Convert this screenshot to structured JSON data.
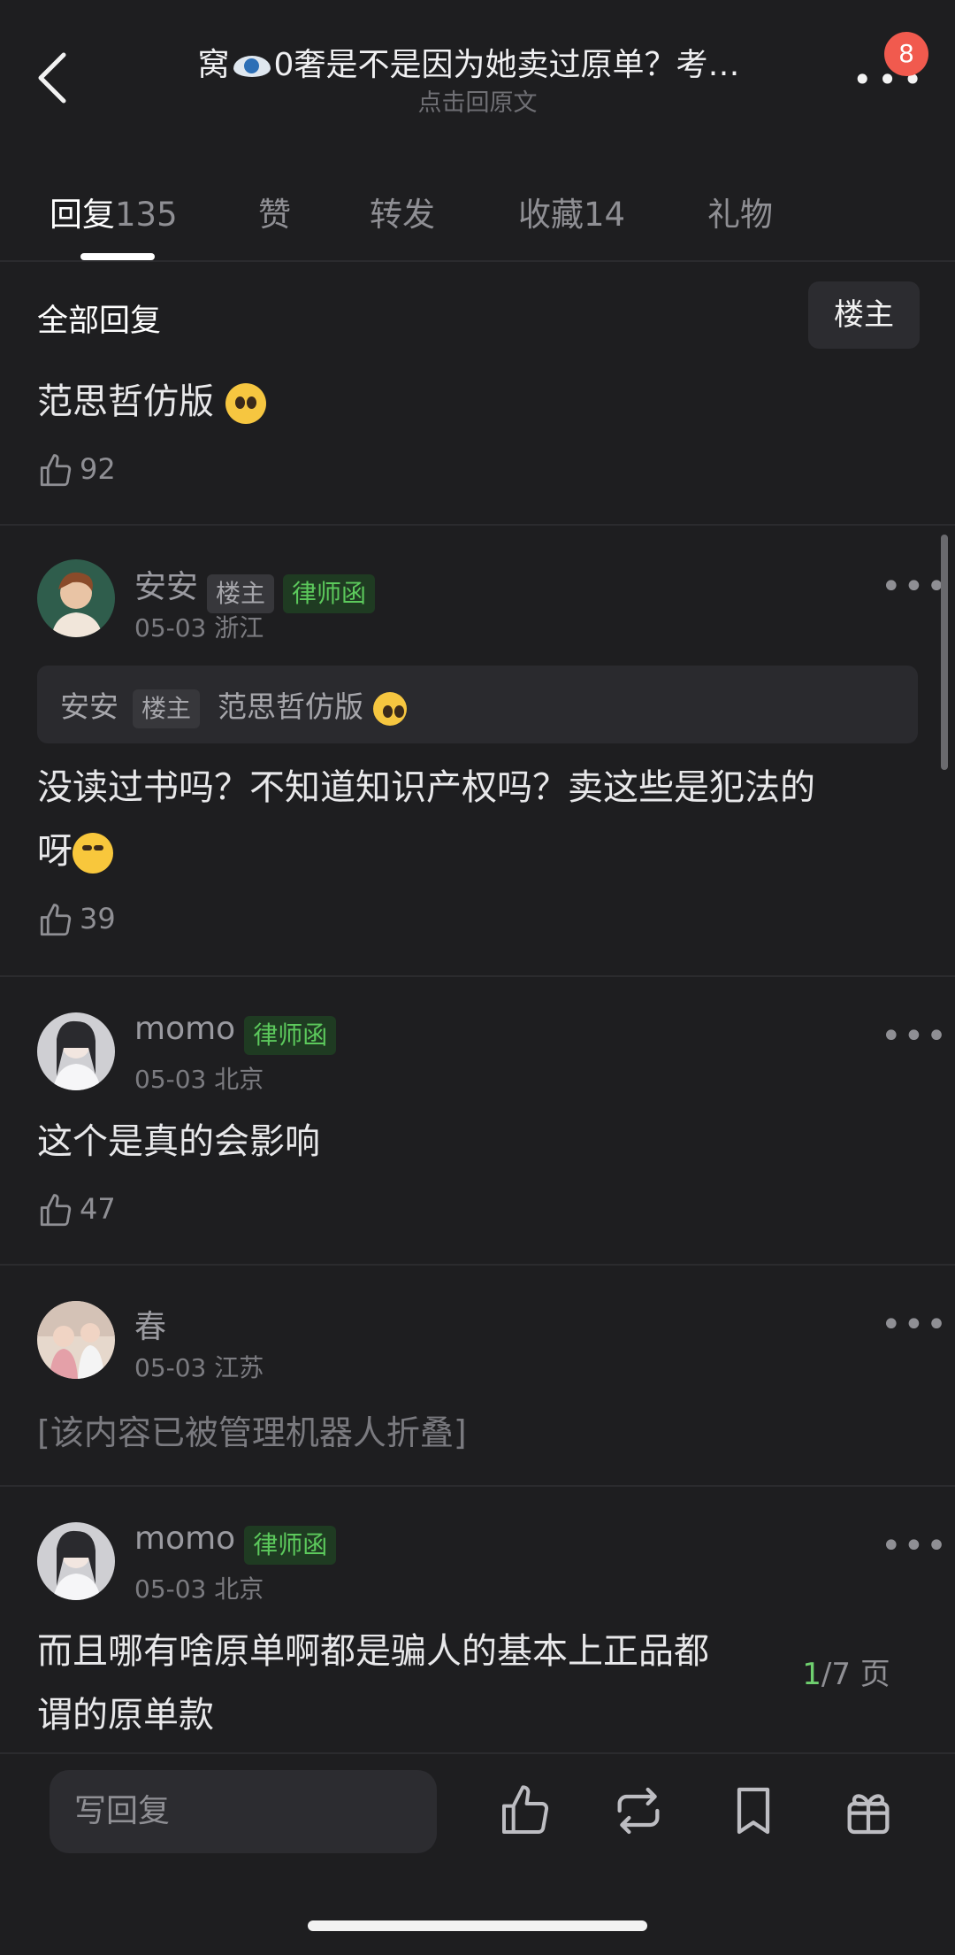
{
  "header": {
    "title_prefix": "窝",
    "title_suffix": "0奢是不是因为她卖过原单？考…",
    "subtitle": "点击回原文",
    "more_glyph": "•••",
    "badge_count": "8"
  },
  "tabs": [
    {
      "label": "回复",
      "count": "135"
    },
    {
      "label": "赞",
      "count": ""
    },
    {
      "label": "转发",
      "count": ""
    },
    {
      "label": "收藏",
      "count": "14"
    },
    {
      "label": "礼物",
      "count": ""
    }
  ],
  "filter": {
    "label": "全部回复",
    "button": "楼主"
  },
  "top_post": {
    "text": "范思哲仿版",
    "likes": "92"
  },
  "comments": [
    {
      "name": "安安",
      "tag_owner": "楼主",
      "tag_green": "律师函",
      "meta": "05-03 浙江",
      "quote_name": "安安",
      "quote_tag": "楼主",
      "quote_text": "范思哲仿版",
      "text_line1": "没读过书吗？不知道知识产权吗？卖这些是犯法的",
      "text_line2": "呀",
      "likes": "39"
    },
    {
      "name": "momo",
      "tag_green": "律师函",
      "meta": "05-03 北京",
      "text": "这个是真的会影响",
      "likes": "47"
    },
    {
      "name": "春",
      "meta": "05-03 江苏",
      "text": "[该内容已被管理机器人折叠]"
    },
    {
      "name": "momo",
      "tag_green": "律师函",
      "meta": "05-03 北京",
      "text_line1": "而且哪有啥原单啊都是骗人的基本上正品都",
      "text_line2": "谓的原单款"
    }
  ],
  "pager": {
    "current": "1",
    "total": "/7 页"
  },
  "bottom": {
    "reply_placeholder": "写回复"
  },
  "colors": {
    "background": "#1e1e20",
    "accent_green": "#5cc95c",
    "badge_red": "#f15a4e"
  }
}
